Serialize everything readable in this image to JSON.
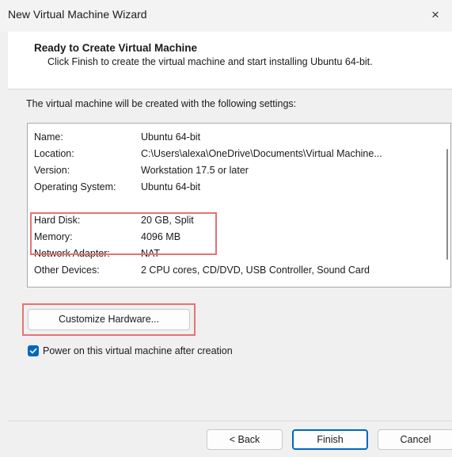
{
  "window": {
    "title": "New Virtual Machine Wizard",
    "close_glyph": "×"
  },
  "header": {
    "title": "Ready to Create Virtual Machine",
    "description": "Click Finish to create the virtual machine and start installing Ubuntu 64-bit."
  },
  "body": {
    "intro": "The virtual machine will be created with the following settings:",
    "settings": {
      "name_label": "Name:",
      "name_value": "Ubuntu 64-bit",
      "location_label": "Location:",
      "location_value": "C:\\Users\\alexa\\OneDrive\\Documents\\Virtual Machine...",
      "version_label": "Version:",
      "version_value": "Workstation 17.5 or later",
      "os_label": "Operating System:",
      "os_value": "Ubuntu 64-bit",
      "disk_label": "Hard Disk:",
      "disk_value": "20 GB, Split",
      "memory_label": "Memory:",
      "memory_value": "4096 MB",
      "network_label": "Network Adapter:",
      "network_value": "NAT",
      "devices_label": "Other Devices:",
      "devices_value": "2 CPU cores, CD/DVD, USB Controller, Sound Card"
    },
    "customize_button": "Customize Hardware...",
    "power_on_checkbox": {
      "label": "Power on this virtual machine after creation",
      "checked": true
    }
  },
  "footer": {
    "back_button": "< Back",
    "finish_button": "Finish",
    "cancel_button": "Cancel"
  },
  "colors": {
    "accent": "#0067c0",
    "highlight": "#e57373"
  }
}
